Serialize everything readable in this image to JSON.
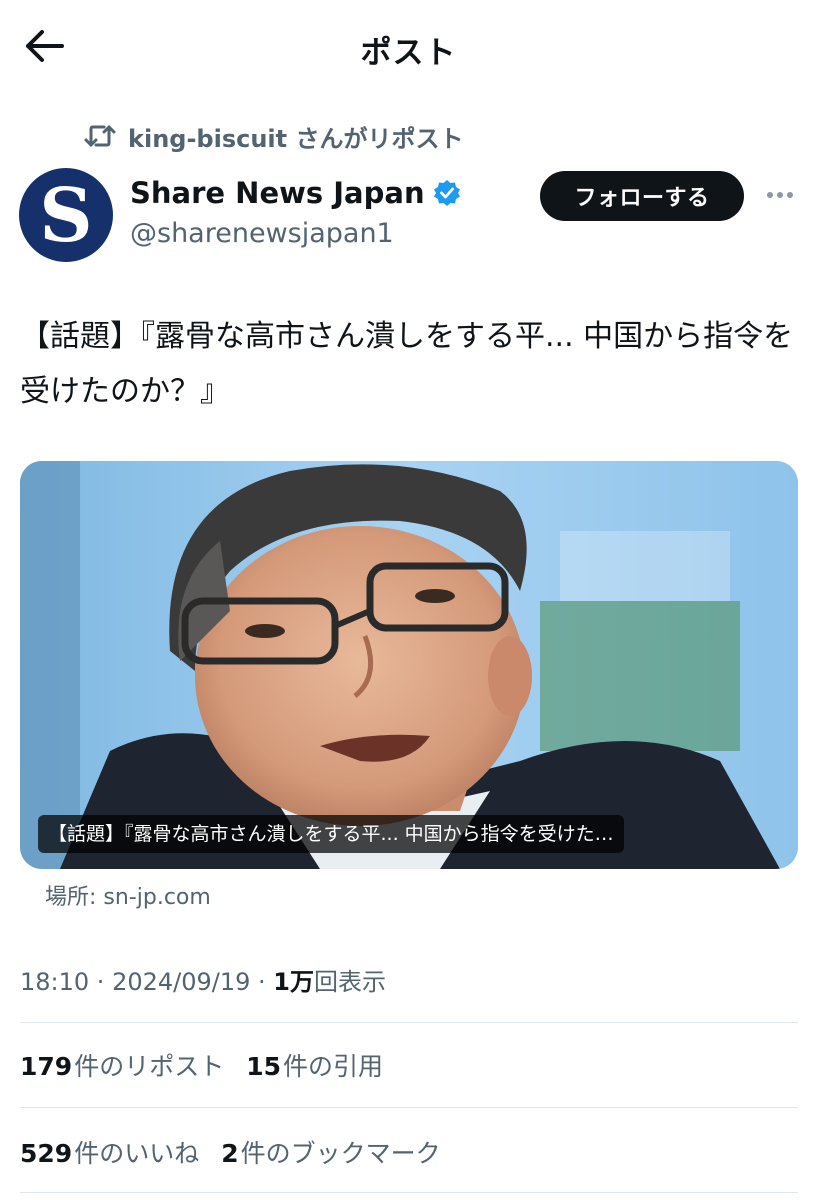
{
  "header": {
    "title": "ポスト",
    "back_icon": "arrow-left-icon"
  },
  "repost": {
    "icon": "repost-icon",
    "text": "king-biscuit さんがリポスト"
  },
  "author": {
    "avatar_letter": "S",
    "name": "Share News Japan",
    "handle": "@sharenewsjapan1",
    "verified_color": "#1d9bf0"
  },
  "actions": {
    "follow_label": "フォローする",
    "more_icon": "more-horizontal-icon"
  },
  "post": {
    "text": "【話題】『露骨な高市さん潰しをする平... 中国から指令を受けたのか？』"
  },
  "card": {
    "caption": "【話題】『露骨な高市さん潰しをする平... 中国から指令を受けた…",
    "source": "場所: sn-jp.com"
  },
  "meta": {
    "time": "18:10",
    "sep": " · ",
    "date": "2024/09/19",
    "views_count": "1万",
    "views_label": "回表示"
  },
  "stats": {
    "reposts_count": "179",
    "reposts_label": "件のリポスト",
    "quotes_count": "15",
    "quotes_label": "件の引用",
    "likes_count": "529",
    "likes_label": "件のいいね",
    "bookmarks_count": "2",
    "bookmarks_label": "件のブックマーク"
  },
  "colors": {
    "text_primary": "#0f1419",
    "text_secondary": "#536471",
    "avatar_bg": "#15306b",
    "divider": "#e1e6ea"
  }
}
